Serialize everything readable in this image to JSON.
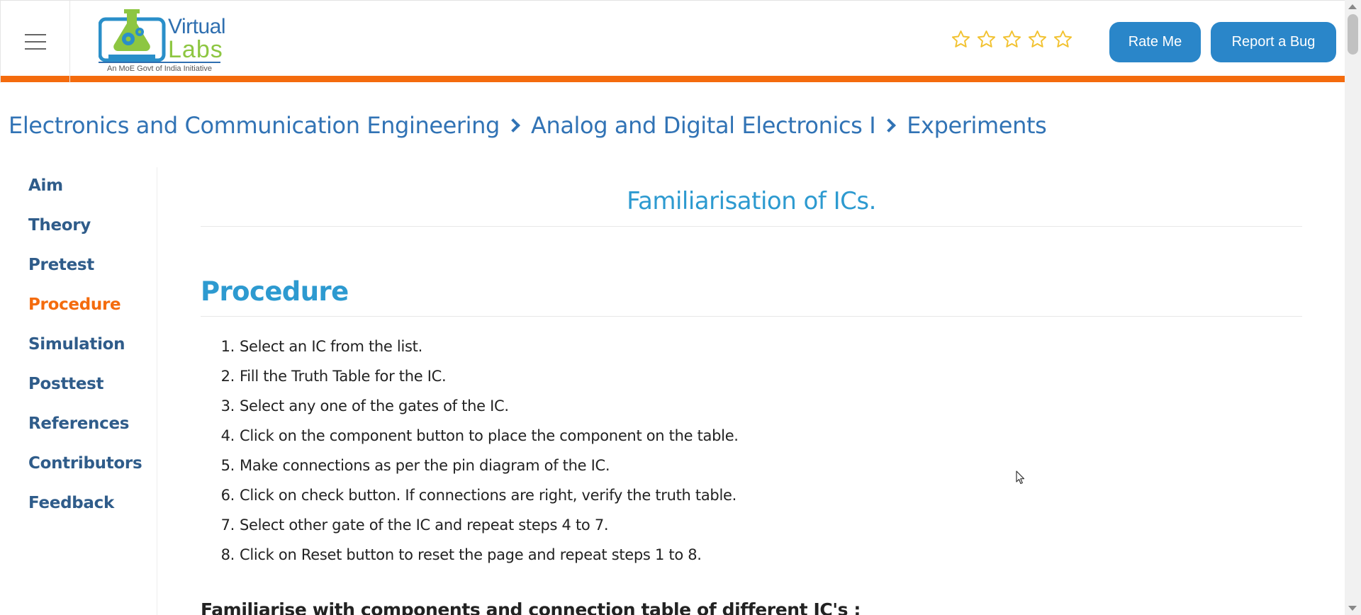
{
  "header": {
    "logo": {
      "line1": "Virtual",
      "line2": "Labs",
      "tagline": "An MoE Govt of India Initiative"
    },
    "rating_stars": 5,
    "rate_button": "Rate Me",
    "bug_button": "Report a Bug",
    "accent_color": "#f46b0d",
    "button_color": "#2a86c9"
  },
  "breadcrumb": {
    "items": [
      "Electronics and Communication Engineering",
      "Analog and Digital Electronics I",
      "Experiments"
    ]
  },
  "sidebar": {
    "items": [
      {
        "label": "Aim"
      },
      {
        "label": "Theory"
      },
      {
        "label": "Pretest"
      },
      {
        "label": "Procedure",
        "active": true
      },
      {
        "label": "Simulation"
      },
      {
        "label": "Posttest"
      },
      {
        "label": "References"
      },
      {
        "label": "Contributors"
      },
      {
        "label": "Feedback"
      }
    ]
  },
  "main": {
    "title": "Familiarisation of ICs.",
    "section_heading": "Procedure",
    "steps": [
      {
        "num": "1.",
        "text": "Select an IC from the list."
      },
      {
        "num": "2.",
        "text": "Fill the Truth Table for the IC."
      },
      {
        "num": "3.",
        "text": "Select any one of the gates of the IC."
      },
      {
        "num": "4.",
        "text": "Click on the component button to place the component on the table."
      },
      {
        "num": "5.",
        "text": "Make connections as per the pin diagram of the IC."
      },
      {
        "num": "6.",
        "text": "Click on check button. If connections are right, verify the truth table."
      },
      {
        "num": "7.",
        "text": "Select other gate of the IC and repeat steps 4 to 7."
      },
      {
        "num": "8.",
        "text": "Click on Reset button to reset the page and repeat steps 1 to 8."
      }
    ],
    "subheading": "Familiarise with components and connection table of different IC's :"
  }
}
